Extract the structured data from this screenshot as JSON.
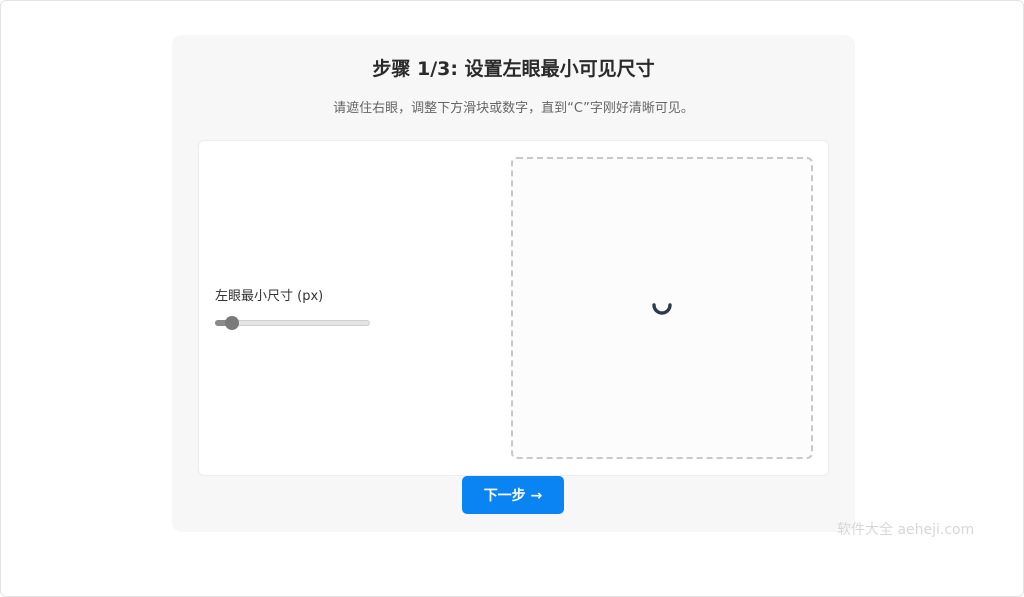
{
  "step": {
    "title": "步骤 1/3: 设置左眼最小可见尺寸",
    "instruction": "请遮住右眼，调整下方滑块或数字，直到“C”字刚好清晰可见。"
  },
  "control": {
    "label": "左眼最小尺寸 (px)",
    "slider_fraction": 0.11
  },
  "preview": {
    "state_icon": "loading-spinner-icon"
  },
  "actions": {
    "next_label": "下一步 →"
  },
  "watermark": "软件大全 aeheji.com",
  "colors": {
    "primary_button": "#0b84f3",
    "spinner": "#2d3a4a",
    "card_background": "#f7f7f7"
  }
}
